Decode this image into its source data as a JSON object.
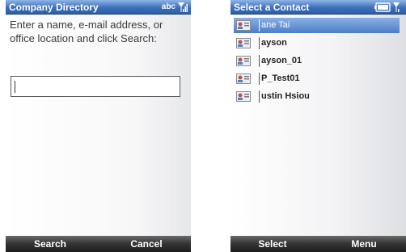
{
  "left_screen": {
    "title": "Company Directory",
    "input_indicator": "abc",
    "prompt": "Enter a name, e-mail address, or office location and click Search:",
    "search_value": "",
    "softkeys": {
      "left": "Search",
      "right": "Cancel"
    }
  },
  "right_screen": {
    "title": "Select a Contact",
    "contacts": [
      {
        "name": "ane Tai",
        "selected": true
      },
      {
        "name": "ayson",
        "selected": false
      },
      {
        "name": "ayson_01",
        "selected": false
      },
      {
        "name": "P_Test01",
        "selected": false
      },
      {
        "name": "ustin Hsiou",
        "selected": false
      }
    ],
    "softkeys": {
      "left": "Select",
      "right": "Menu"
    }
  },
  "icons": {
    "signal": "signal-strength-icon",
    "battery": "battery-icon",
    "contact": "contact-card-icon"
  },
  "colors": {
    "titlebar": "#3e6fb8",
    "selection": "#4b7ec8",
    "softkey_bar": "#2a2a2a"
  }
}
